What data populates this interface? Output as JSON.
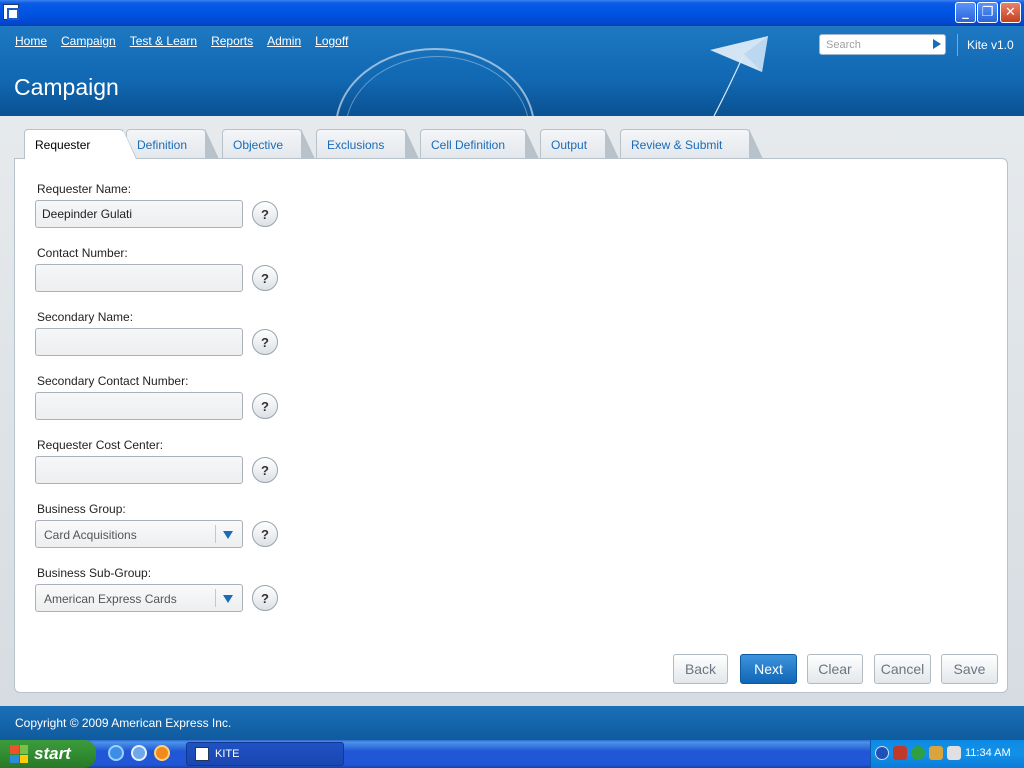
{
  "window": {
    "minimize": "_",
    "maximize": "❐",
    "close": "✕"
  },
  "nav": [
    "Home",
    "Campaign",
    "Test & Learn",
    "Reports",
    "Admin",
    "Logoff"
  ],
  "page_title": "Campaign",
  "search": {
    "placeholder": "Search"
  },
  "version": "Kite v1.0",
  "tabs": [
    "Requester",
    "Definition",
    "Objective",
    "Exclusions",
    "Cell Definition",
    "Output",
    "Review & Submit"
  ],
  "form": {
    "requester_name": {
      "label": "Requester Name:",
      "value": "Deepinder Gulati"
    },
    "contact_number": {
      "label": "Contact Number:",
      "value": ""
    },
    "secondary_name": {
      "label": "Secondary Name:",
      "value": ""
    },
    "secondary_contact": {
      "label": "Secondary Contact Number:",
      "value": ""
    },
    "cost_center": {
      "label": "Requester Cost Center:",
      "value": ""
    },
    "business_group": {
      "label": "Business Group:",
      "value": "Card Acquisitions"
    },
    "business_subgroup": {
      "label": "Business Sub-Group:",
      "value": "American Express Cards"
    },
    "help": "?"
  },
  "buttons": {
    "back": "Back",
    "next": "Next",
    "clear": "Clear",
    "cancel": "Cancel",
    "save": "Save"
  },
  "footer": "Copyright © 2009 American Express Inc.",
  "taskbar": {
    "start": "start",
    "task": "KITE",
    "clock": "11:34 AM"
  },
  "colors": {
    "brand_blue": "#1269b3",
    "tab_link": "#1a6bb8",
    "primary_button": "#1166b6"
  }
}
